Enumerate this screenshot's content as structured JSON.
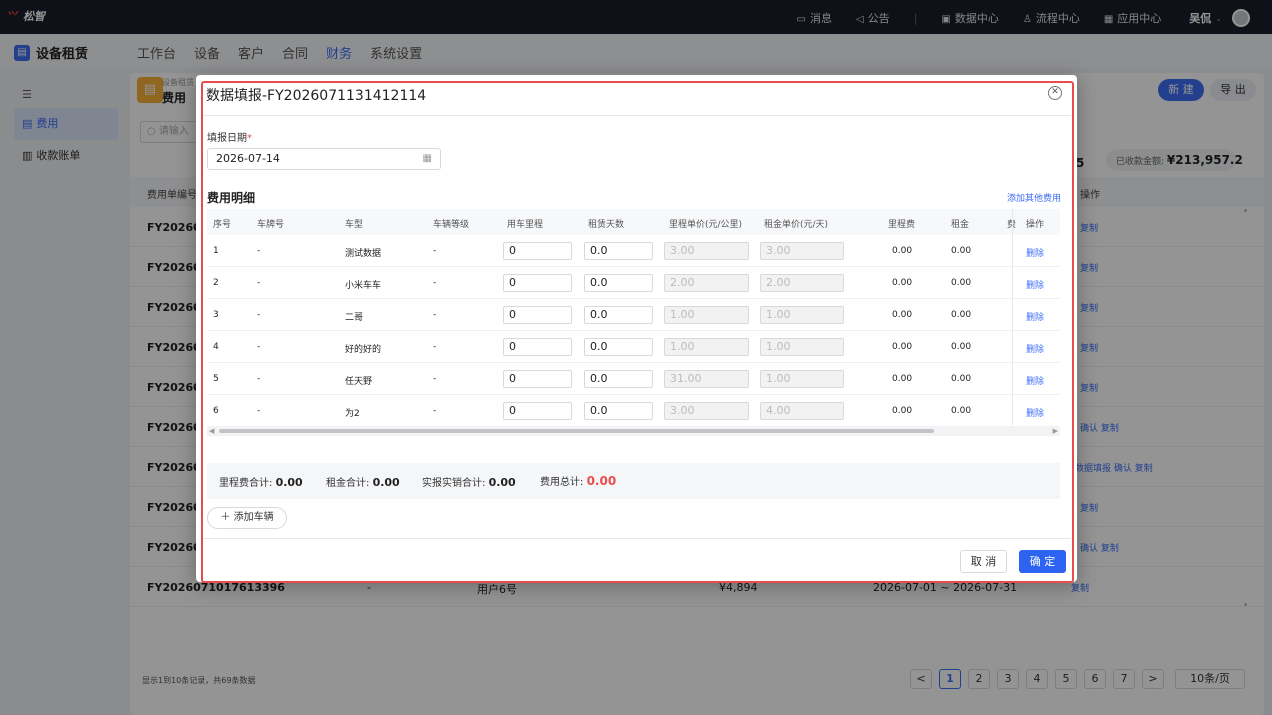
{
  "topbar": {
    "logo": "松智",
    "messages": "消息",
    "notice": "公告",
    "data_center": "数据中心",
    "flow_center": "流程中心",
    "app_center": "应用中心",
    "user": "吴侃"
  },
  "header": {
    "brand": "设备租赁",
    "nav": [
      "工作台",
      "设备",
      "客户",
      "合同",
      "财务",
      "系统设置"
    ],
    "active": "财务"
  },
  "sidebar": {
    "items": [
      {
        "label": "费用"
      },
      {
        "label": "收款账单"
      }
    ]
  },
  "page": {
    "crumb": "设备租赁",
    "title": "费用",
    "new_btn": "新 建",
    "export_btn": "导 出",
    "search_placeholder": "请输入",
    "count_tail": "5",
    "received_label": "已收款金额:",
    "received_value": "¥213,957.2"
  },
  "table": {
    "headers": [
      "费用单编号",
      "操作"
    ],
    "rows": [
      {
        "id": "FY202607",
        "ops": "复制"
      },
      {
        "id": "FY202607",
        "ops": "复制"
      },
      {
        "id": "FY202607",
        "ops": "复制"
      },
      {
        "id": "FY202607",
        "ops": "复制"
      },
      {
        "id": "FY202607",
        "ops": "复制"
      },
      {
        "id": "FY202607",
        "ops": "确认 复制"
      },
      {
        "id": "FY202607",
        "ops": "数据填报 确认 复制"
      },
      {
        "id": "FY202607",
        "ops": "复制"
      },
      {
        "id": "FY202607",
        "ops": "确认 复制"
      },
      {
        "id": "FY2026071017613396",
        "plate": "-",
        "customer": "用户6号",
        "amount": "¥4,894",
        "period": "2026-07-01 ~ 2026-07-31",
        "ops": "复制"
      }
    ]
  },
  "footer": {
    "info": "显示1到10条记录，共69条数据",
    "pages": [
      "<",
      "1",
      "2",
      "3",
      "4",
      "5",
      "6",
      "7",
      ">"
    ],
    "current": "1",
    "page_size": "10条/页"
  },
  "modal": {
    "title": "数据填报-FY2026071131412114",
    "date_label": "填报日期",
    "date_value": "2026-07-14",
    "section_title": "费用明细",
    "add_other": "添加其他费用",
    "columns": [
      "序号",
      "车牌号",
      "车型",
      "车辆等级",
      "用车里程",
      "租赁天数",
      "里程单价(元/公里)",
      "租金单价(元/天)",
      "里程费",
      "租金",
      "费",
      "操作"
    ],
    "rows": [
      {
        "no": "1",
        "plate": "-",
        "model": "测试数据",
        "level": "-",
        "mileage": "0",
        "days": "0.0",
        "mile_price": "3.00",
        "rent_price": "3.00",
        "mile_fee": "0.00",
        "rent": "0.00",
        "op": "删除"
      },
      {
        "no": "2",
        "plate": "-",
        "model": "小米车车",
        "level": "-",
        "mileage": "0",
        "days": "0.0",
        "mile_price": "2.00",
        "rent_price": "2.00",
        "mile_fee": "0.00",
        "rent": "0.00",
        "op": "删除"
      },
      {
        "no": "3",
        "plate": "-",
        "model": "二哥",
        "level": "-",
        "mileage": "0",
        "days": "0.0",
        "mile_price": "1.00",
        "rent_price": "1.00",
        "mile_fee": "0.00",
        "rent": "0.00",
        "op": "删除"
      },
      {
        "no": "4",
        "plate": "-",
        "model": "好的好的",
        "level": "-",
        "mileage": "0",
        "days": "0.0",
        "mile_price": "1.00",
        "rent_price": "1.00",
        "mile_fee": "0.00",
        "rent": "0.00",
        "op": "删除"
      },
      {
        "no": "5",
        "plate": "-",
        "model": "任天野",
        "level": "-",
        "mileage": "0",
        "days": "0.0",
        "mile_price": "31.00",
        "rent_price": "1.00",
        "mile_fee": "0.00",
        "rent": "0.00",
        "op": "删除"
      },
      {
        "no": "6",
        "plate": "-",
        "model": "为2",
        "level": "-",
        "mileage": "0",
        "days": "0.0",
        "mile_price": "3.00",
        "rent_price": "4.00",
        "mile_fee": "0.00",
        "rent": "0.00",
        "op": "删除"
      }
    ],
    "summary": {
      "mile_label": "里程费合计:",
      "mile_total": "0.00",
      "rent_label": "租金合计:",
      "rent_total": "0.00",
      "actual_label": "实报实销合计:",
      "actual_total": "0.00",
      "total_label": "费用总计:",
      "total": "0.00"
    },
    "add_vehicle": "添加车辆",
    "cancel": "取 消",
    "ok": "确 定"
  }
}
